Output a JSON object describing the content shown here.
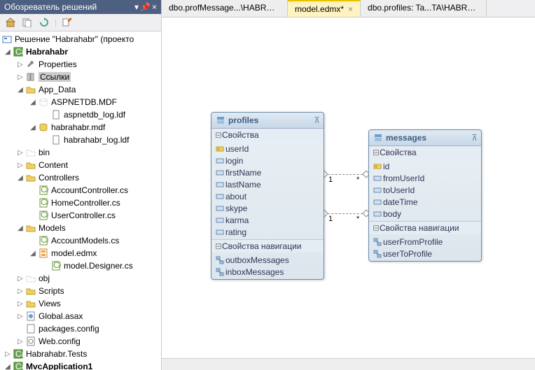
{
  "panel": {
    "title": "Обозреватель решений",
    "pin_icon": "📌",
    "close_icon": "×",
    "dropdown_icon": "▾"
  },
  "toolbar": {
    "b1": "🏠",
    "b2": "📄",
    "b3": "↻",
    "b4": "⚡",
    "sep": "|"
  },
  "tree": {
    "solution_label": "Решение \"Habrahabr\" (проекто",
    "project": "Habrahabr",
    "properties": "Properties",
    "refs": "Ссылки",
    "app_data": "App_Data",
    "aspnetdb": "ASPNETDB.MDF",
    "aspnetdb_log": "aspnetdb_log.ldf",
    "habrahabr_mdf": "habrahabr.mdf",
    "habrahabr_log": "habrahabr_log.ldf",
    "bin": "bin",
    "content": "Content",
    "controllers": "Controllers",
    "account_ctrl": "AccountController.cs",
    "home_ctrl": "HomeController.cs",
    "user_ctrl": "UserController.cs",
    "models": "Models",
    "account_models": "AccountModels.cs",
    "model_edmx": "model.edmx",
    "model_designer": "model.Designer.cs",
    "obj": "obj",
    "scripts": "Scripts",
    "views": "Views",
    "global_asax": "Global.asax",
    "packages": "packages.config",
    "web_config": "Web.config",
    "tests": "Habrahabr.Tests",
    "mvcapp": "MvcApplication1"
  },
  "tabs": {
    "t1": "dbo.profMessage...\\HABRAHABR.MDF)",
    "t2": "model.edmx*",
    "t3": "dbo.profiles: Ta...TA\\HABRAHABR.M",
    "close": "×"
  },
  "entities": {
    "profiles": {
      "title": "profiles",
      "props_header": "Свойства",
      "props": [
        "userId",
        "login",
        "firstName",
        "lastName",
        "about",
        "skype",
        "karma",
        "rating"
      ],
      "nav_header": "Свойства навигации",
      "nav": [
        "outboxMessages",
        "inboxMessages"
      ]
    },
    "messages": {
      "title": "messages",
      "props_header": "Свойства",
      "props": [
        "id",
        "fromUserId",
        "toUserId",
        "dateTime",
        "body"
      ],
      "nav_header": "Свойства навигации",
      "nav": [
        "userFromProfile",
        "userToProfile"
      ]
    }
  },
  "multiplicity": {
    "one": "1",
    "many": "*"
  },
  "chart_data": {
    "type": "diagram",
    "entities": [
      {
        "name": "profiles",
        "properties": [
          "userId",
          "login",
          "firstName",
          "lastName",
          "about",
          "skype",
          "karma",
          "rating"
        ],
        "navigation": [
          "outboxMessages",
          "inboxMessages"
        ]
      },
      {
        "name": "messages",
        "properties": [
          "id",
          "fromUserId",
          "toUserId",
          "dateTime",
          "body"
        ],
        "navigation": [
          "userFromProfile",
          "userToProfile"
        ]
      }
    ],
    "relations": [
      {
        "from": "profiles",
        "to": "messages",
        "from_mult": "1",
        "to_mult": "*"
      },
      {
        "from": "profiles",
        "to": "messages",
        "from_mult": "1",
        "to_mult": "*"
      }
    ]
  }
}
